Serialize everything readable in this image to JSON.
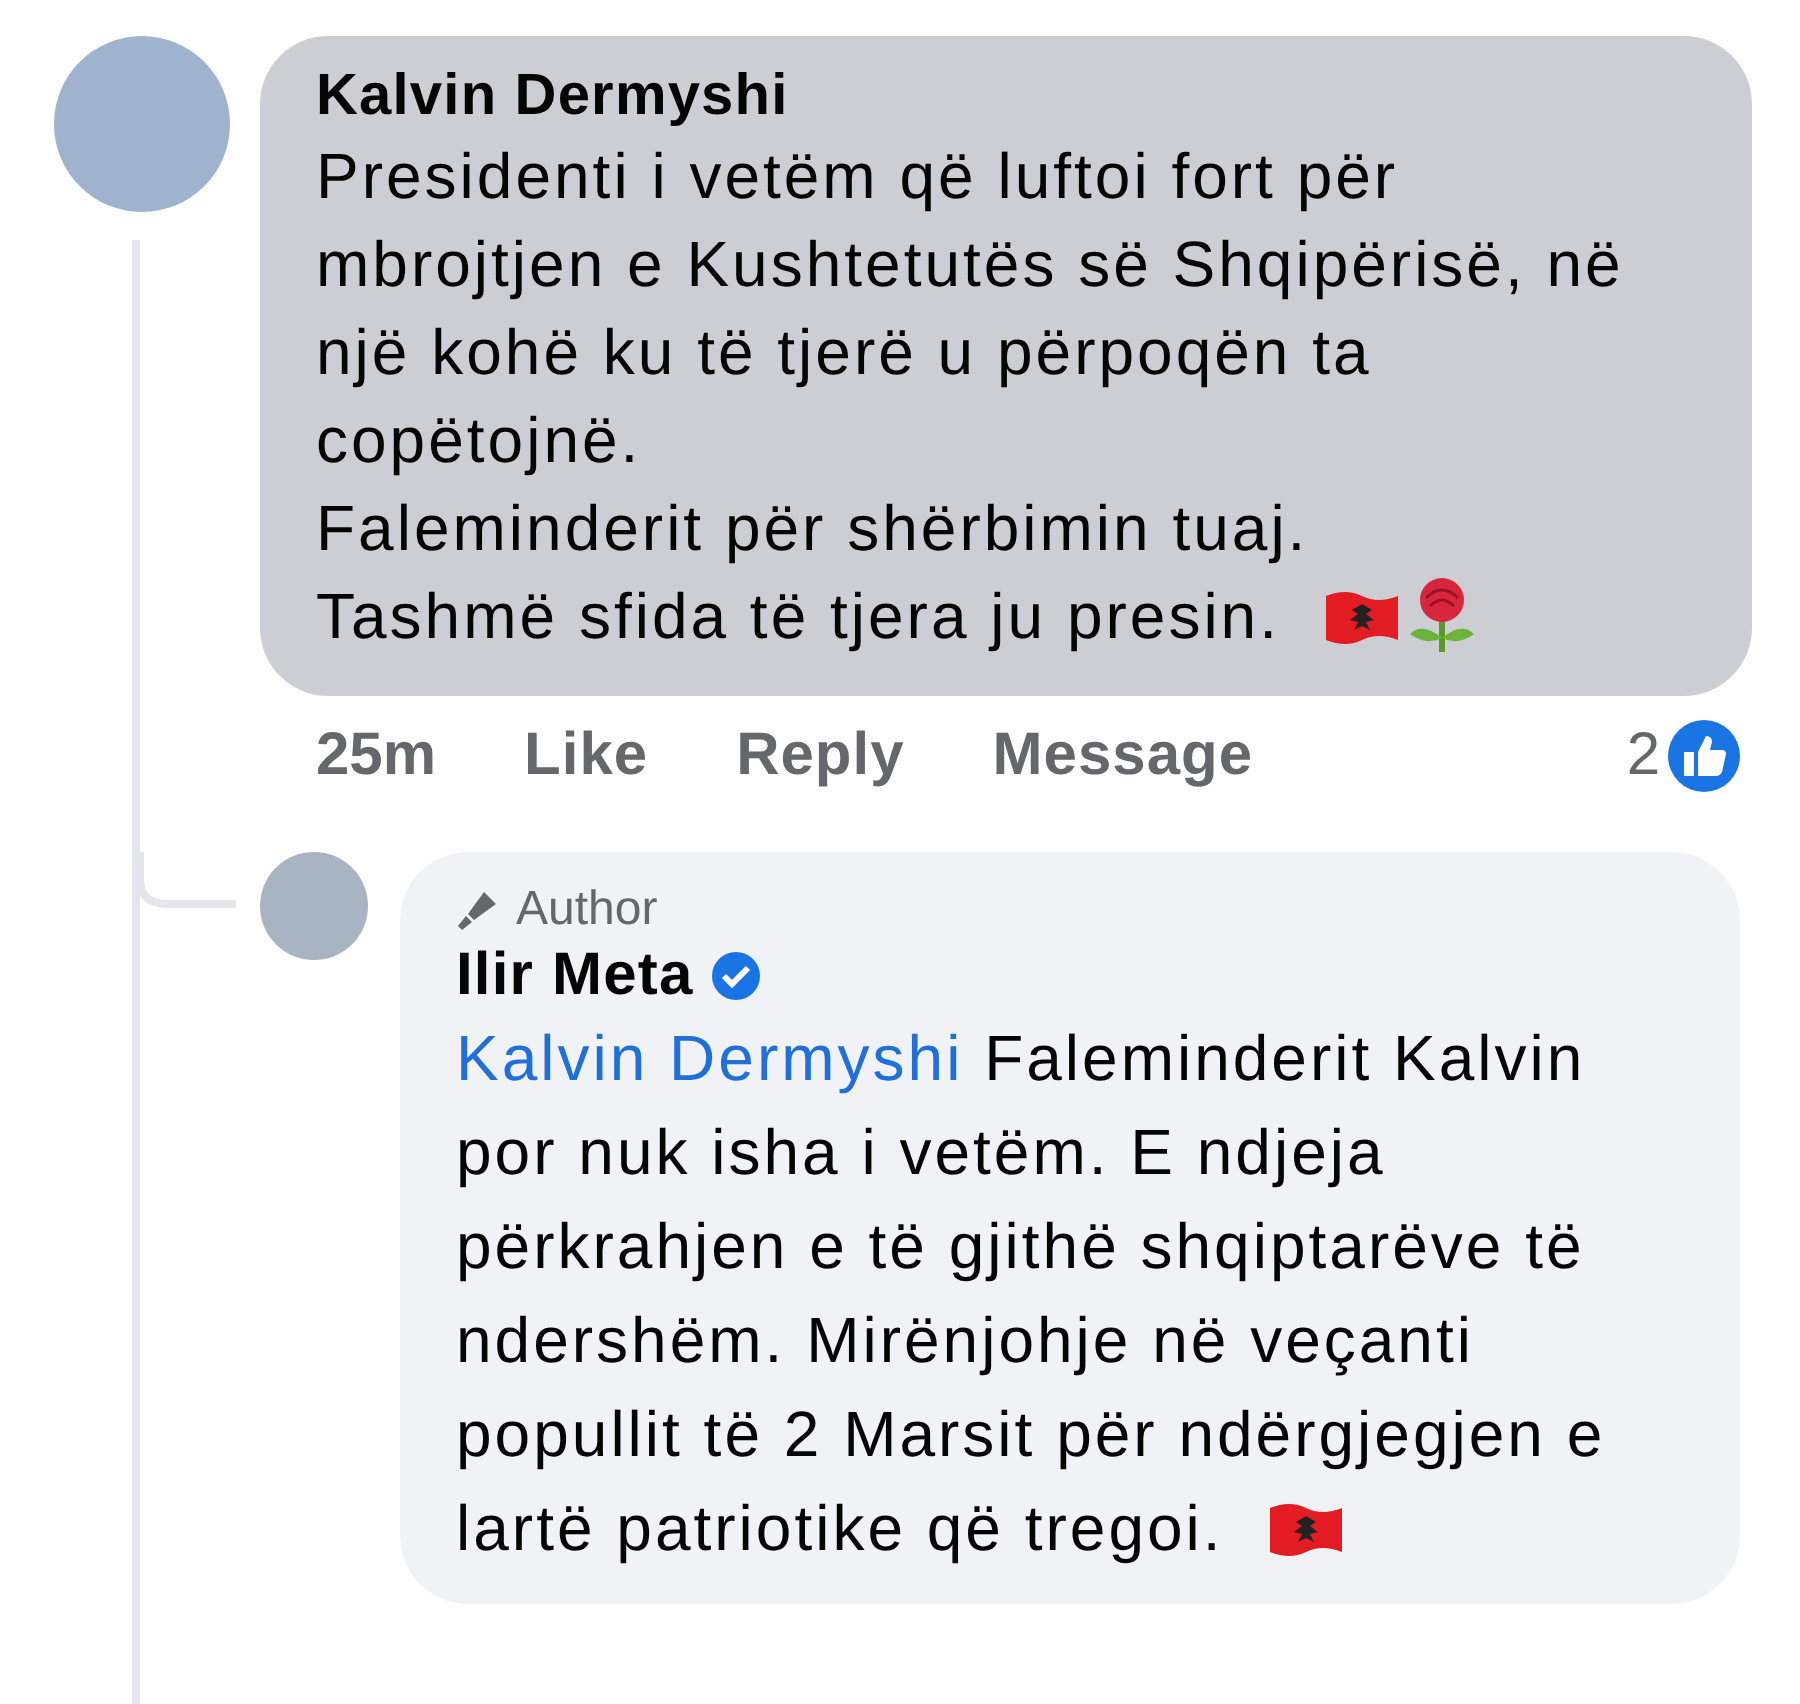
{
  "comment": {
    "author": "Kalvin Dermyshi",
    "paragraphs": [
      "Presidenti i vetëm që luftoi fort për mbrojtjen e Kushtetutës së Shqipërisë, në një kohë ku të tjerë u përpoqën ta copëtojnë.",
      "Faleminderit për shërbimin tuaj.",
      "Tashmë sfida të tjera ju presin."
    ],
    "time": "25m",
    "actions": [
      "Like",
      "Reply",
      "Message"
    ],
    "reaction_count": "2"
  },
  "reply": {
    "badge": "Author",
    "author": "Ilir Meta",
    "verified": true,
    "mention": "Kalvin Dermyshi",
    "text": "Faleminderit Kalvin por nuk isha i vetëm. E ndjeja përkrahjen e të gjithë shqiptarëve të ndershëm. Mirënjohje në veçanti popullit të 2 Marsit për ndërgjegjen e lartë patriotike që tregoi."
  }
}
